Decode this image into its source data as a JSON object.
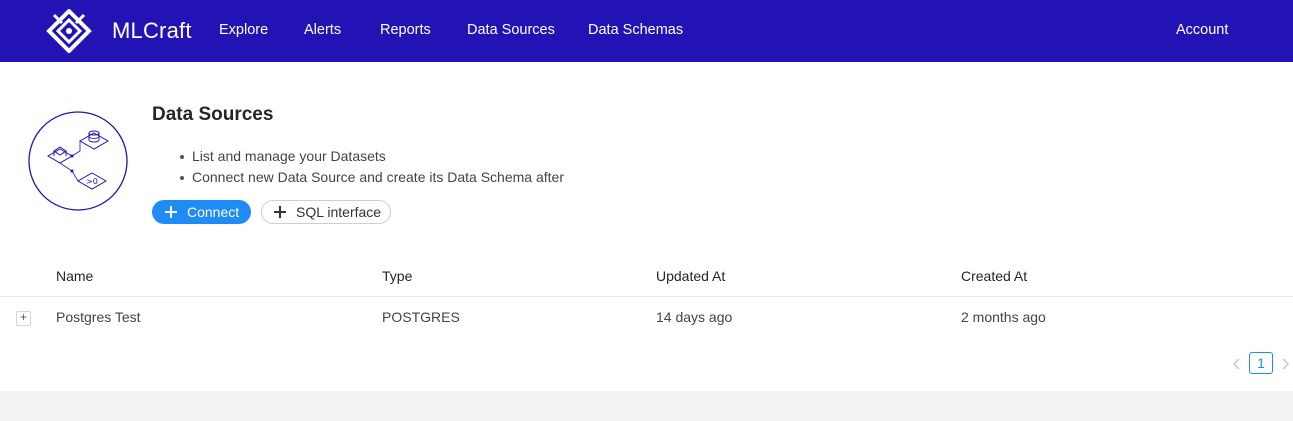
{
  "app": {
    "brand": "MLCraft",
    "logo_icon": "mlcraft-logo-icon",
    "nav": [
      {
        "label": "Explore"
      },
      {
        "label": "Alerts"
      },
      {
        "label": "Reports"
      },
      {
        "label": "Data Sources"
      },
      {
        "label": "Data Schemas"
      }
    ],
    "account_label": "Account",
    "colors": {
      "header": "#2313b4",
      "accent": "#1f8cf5"
    }
  },
  "page": {
    "title": "Data Sources",
    "illustration_icon": "database-network-illustration",
    "bullets": [
      "List and manage your Datasets",
      "Connect new Data Source and create its Data Schema after"
    ],
    "buttons": {
      "connect_label": "Connect",
      "sql_label": "SQL interface"
    }
  },
  "table": {
    "columns": [
      "Name",
      "Type",
      "Updated At",
      "Created At"
    ],
    "rows": [
      {
        "expand": "+",
        "name": "Postgres Test",
        "type": "POSTGRES",
        "updated_at": "14 days ago",
        "created_at": "2 months ago"
      }
    ]
  },
  "pagination": {
    "current_page": "1"
  }
}
